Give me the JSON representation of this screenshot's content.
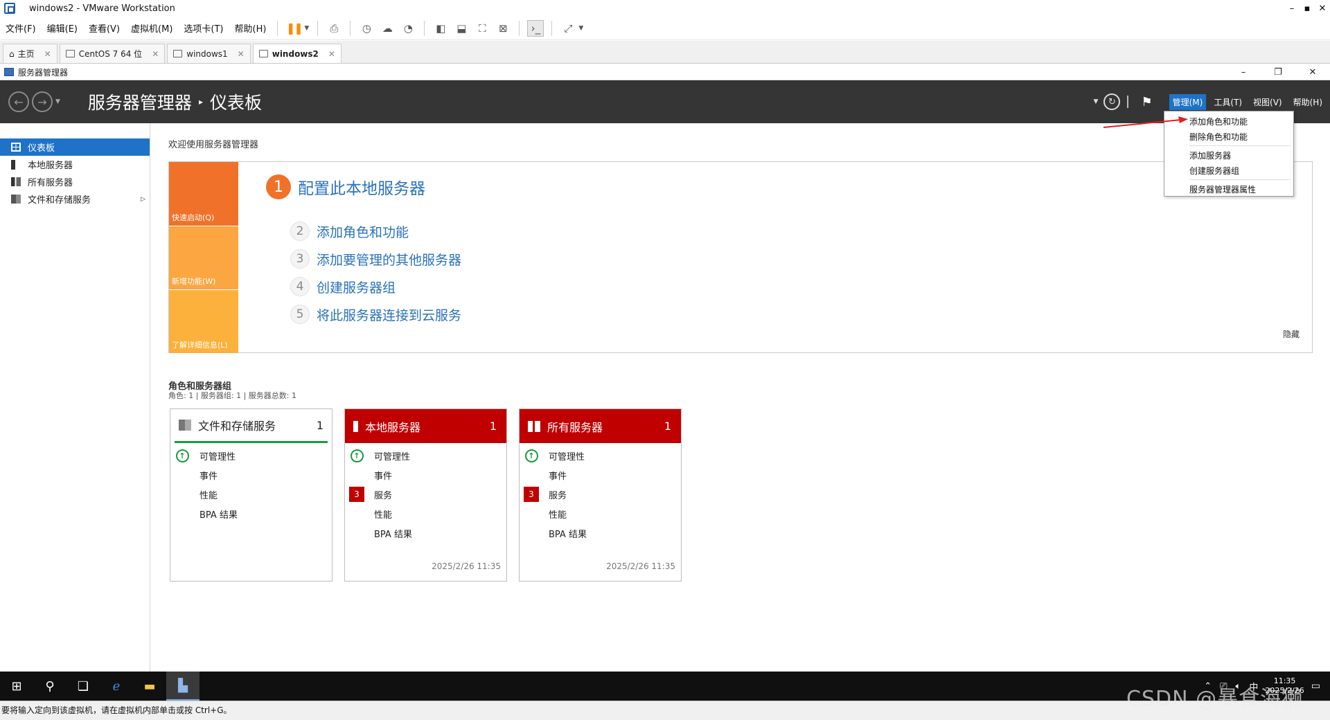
{
  "vmware": {
    "window_title": "windows2 - VMware Workstation",
    "window_controls": [
      "–",
      "▪",
      "✕"
    ],
    "menus": [
      "文件(F)",
      "编辑(E)",
      "查看(V)",
      "虚拟机(M)",
      "选项卡(T)",
      "帮助(H)"
    ],
    "tabs": [
      {
        "label": "主页",
        "active": false
      },
      {
        "label": "CentOS 7 64 位",
        "active": false
      },
      {
        "label": "windows1",
        "active": false
      },
      {
        "label": "windows2",
        "active": true
      }
    ],
    "status_text": "要将输入定向到该虚拟机，请在虚拟机内部单击或按 Ctrl+G。"
  },
  "server_manager": {
    "caption": "服务器管理器",
    "caption_controls": [
      "–",
      "❐",
      "✕"
    ],
    "breadcrumb": {
      "app": "服务器管理器",
      "page": "仪表板"
    },
    "header_menus": [
      {
        "label": "管理(M)",
        "open": true
      },
      {
        "label": "工具(T)",
        "open": false
      },
      {
        "label": "视图(V)",
        "open": false
      },
      {
        "label": "帮助(H)",
        "open": false
      }
    ],
    "manage_menu": [
      "添加角色和功能",
      "删除角色和功能",
      "添加服务器",
      "创建服务器组",
      "服务器管理器属性"
    ],
    "sidebar": [
      {
        "label": "仪表板",
        "icon": "dashboard-icon",
        "active": true
      },
      {
        "label": "本地服务器",
        "icon": "server-icon",
        "active": false
      },
      {
        "label": "所有服务器",
        "icon": "servers-icon",
        "active": false
      },
      {
        "label": "文件和存储服务",
        "icon": "storage-icon",
        "active": false,
        "has_children": true
      }
    ],
    "welcome": {
      "title": "欢迎使用服务器管理器",
      "tiles": [
        "快速启动(Q)",
        "新增功能(W)",
        "了解详细信息(L)"
      ],
      "step1": {
        "num": "1",
        "label": "配置此本地服务器"
      },
      "steps": [
        {
          "num": "2",
          "label": "添加角色和功能"
        },
        {
          "num": "3",
          "label": "添加要管理的其他服务器"
        },
        {
          "num": "4",
          "label": "创建服务器组"
        },
        {
          "num": "5",
          "label": "将此服务器连接到云服务"
        }
      ],
      "hide": "隐藏"
    },
    "roles": {
      "title": "角色和服务器组",
      "subtitle": "角色: 1 | 服务器组: 1 | 服务器总数: 1",
      "cards": [
        {
          "title": "文件和存储服务",
          "count": "1",
          "rows": [
            "可管理性",
            "事件",
            "性能",
            "BPA 结果"
          ],
          "timestamp": ""
        },
        {
          "title": "本地服务器",
          "count": "1",
          "rows": [
            "可管理性",
            "事件",
            "服务",
            "性能",
            "BPA 结果"
          ],
          "services_badge": "3",
          "timestamp": "2025/2/26 11:35"
        },
        {
          "title": "所有服务器",
          "count": "1",
          "rows": [
            "可管理性",
            "事件",
            "服务",
            "性能",
            "BPA 结果"
          ],
          "services_badge": "3",
          "timestamp": "2025/2/26 11:35"
        }
      ]
    }
  },
  "taskbar": {
    "clock_time": "11:35",
    "clock_date": "2025/2/26",
    "ime": "中"
  },
  "watermark": "CSDN @暴食海獭",
  "colors": {
    "header_bg": "#353535",
    "accent_blue": "#1e73c8",
    "orange": "#f0722a",
    "alert_red": "#c00000",
    "ok_green": "#1a9a3c"
  }
}
